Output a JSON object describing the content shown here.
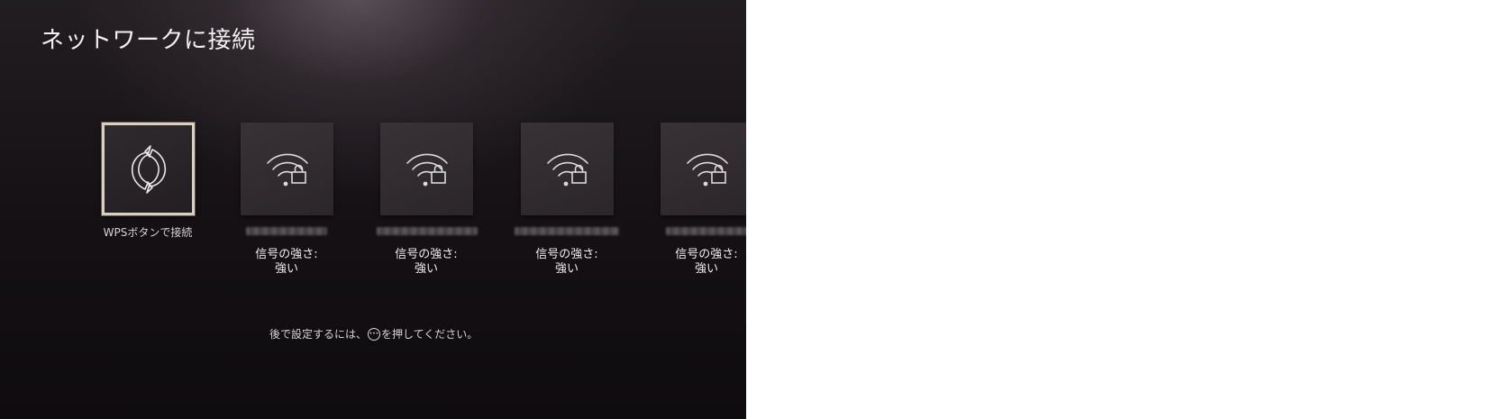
{
  "header": {
    "title": "ネットワークに接続"
  },
  "wps": {
    "label": "WPSボタンで接続",
    "icon": "wps-sync-icon"
  },
  "networks": [
    {
      "ssid": "",
      "signal_label": "信号の強さ:",
      "signal_value": "強い",
      "icon": "wifi-lock-icon"
    },
    {
      "ssid": "",
      "signal_label": "信号の強さ:",
      "signal_value": "強い",
      "icon": "wifi-lock-icon"
    },
    {
      "ssid": "",
      "signal_label": "信号の強さ:",
      "signal_value": "強い",
      "icon": "wifi-lock-icon"
    },
    {
      "ssid": "",
      "signal_label": "信号の強さ:",
      "signal_value": "強い",
      "icon": "wifi-lock-icon"
    }
  ],
  "footer": {
    "hint_before": "後で設定するには、",
    "button_glyph": "•••",
    "hint_after": "を押してください。"
  },
  "colors": {
    "background": "#141014",
    "tile": "#2e292d",
    "focus_border": "#d9d0c3",
    "text": "#f0eef0"
  }
}
